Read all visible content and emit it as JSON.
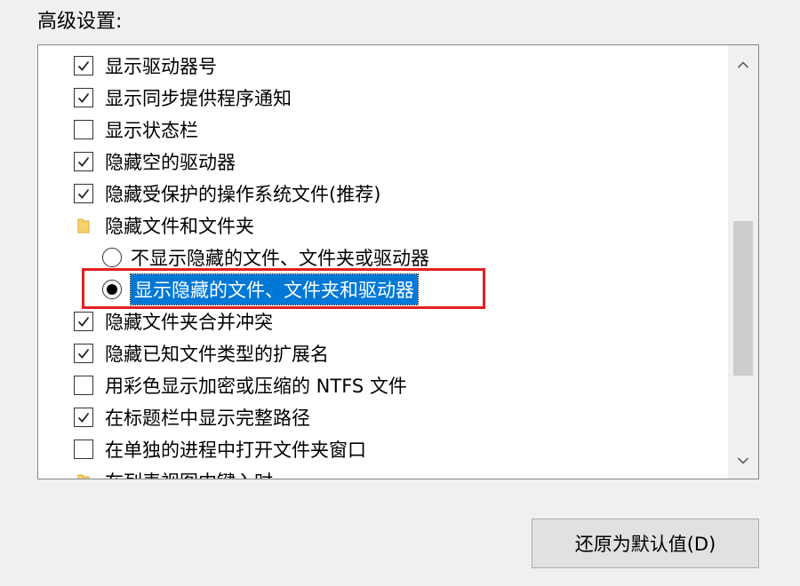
{
  "section": {
    "label": "高级设置:"
  },
  "items": [
    {
      "type": "checkbox",
      "checked": true,
      "label": "显示驱动器号"
    },
    {
      "type": "checkbox",
      "checked": true,
      "label": "显示同步提供程序通知"
    },
    {
      "type": "checkbox",
      "checked": false,
      "label": "显示状态栏"
    },
    {
      "type": "checkbox",
      "checked": true,
      "label": "隐藏空的驱动器"
    },
    {
      "type": "checkbox",
      "checked": true,
      "label": "隐藏受保护的操作系统文件(推荐)"
    },
    {
      "type": "folder",
      "label": "隐藏文件和文件夹"
    },
    {
      "type": "radio",
      "checked": false,
      "label": "不显示隐藏的文件、文件夹或驱动器"
    },
    {
      "type": "radio",
      "checked": true,
      "selected": true,
      "label": "显示隐藏的文件、文件夹和驱动器"
    },
    {
      "type": "checkbox",
      "checked": true,
      "label": "隐藏文件夹合并冲突"
    },
    {
      "type": "checkbox",
      "checked": true,
      "label": "隐藏已知文件类型的扩展名"
    },
    {
      "type": "checkbox",
      "checked": false,
      "label": "用彩色显示加密或压缩的 NTFS 文件"
    },
    {
      "type": "checkbox",
      "checked": true,
      "label": "在标题栏中显示完整路径"
    },
    {
      "type": "checkbox",
      "checked": false,
      "label": "在单独的进程中打开文件夹窗口"
    },
    {
      "type": "folder",
      "label": "在列表视图中键入时"
    }
  ],
  "buttons": {
    "restore_defaults": "还原为默认值(D)"
  },
  "colors": {
    "selection": "#0078d7",
    "highlight_border": "#e02020",
    "window_bg": "#f0f0f0"
  }
}
